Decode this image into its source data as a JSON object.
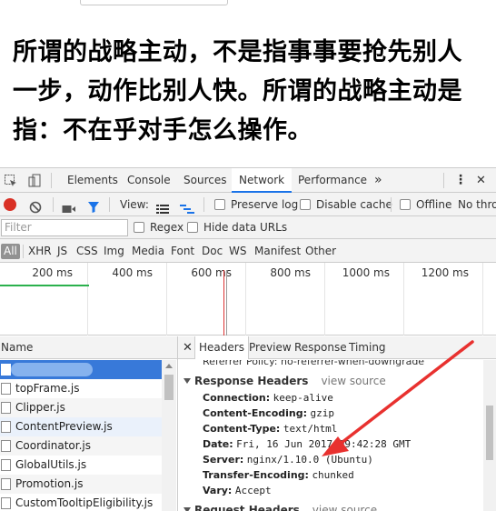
{
  "article": {
    "text": "所谓的战略主动，不是指事事要抢先别人一步，动作比别人快。所谓的战略主动是指：不在乎对手怎么操作。"
  },
  "devtools": {
    "tabs": [
      "Elements",
      "Console",
      "Sources",
      "Network",
      "Performance"
    ],
    "active_tab": "Network",
    "more": "»",
    "close": "✕",
    "menu": "⋮"
  },
  "network_toolbar": {
    "view_label": "View:",
    "preserve_log": "Preserve log",
    "disable_cache": "Disable cache",
    "offline": "Offline",
    "no_throttling": "No thro"
  },
  "filter": {
    "placeholder": "Filter",
    "regex": "Regex",
    "hide_data_urls": "Hide data URLs"
  },
  "types": [
    "All",
    "XHR",
    "JS",
    "CSS",
    "Img",
    "Media",
    "Font",
    "Doc",
    "WS",
    "Manifest",
    "Other"
  ],
  "overview": {
    "ticks": [
      "200 ms",
      "400 ms",
      "600 ms",
      "800 ms",
      "1000 ms",
      "1200 ms"
    ]
  },
  "requests": {
    "header": "Name",
    "items": [
      "topFrame.js",
      "Clipper.js",
      "ContentPreview.js",
      "Coordinator.js",
      "GlobalUtils.js",
      "Promotion.js",
      "CustomTooltipEligibility.js"
    ]
  },
  "detail": {
    "tabs": [
      "Headers",
      "Preview",
      "Response",
      "Timing"
    ],
    "active_tab": "Headers",
    "cut_line": "Referrer Policy: no-referrer-when-downgrade",
    "response_section": "Response Headers",
    "view_source": "view source",
    "headers": [
      {
        "k": "Connection:",
        "v": "keep-alive"
      },
      {
        "k": "Content-Encoding:",
        "v": "gzip"
      },
      {
        "k": "Content-Type:",
        "v": "text/html"
      },
      {
        "k": "Date:",
        "v": "Fri, 16 Jun 2017 09:42:28 GMT"
      },
      {
        "k": "Server:",
        "v": "nginx/1.10.0 (Ubuntu)"
      },
      {
        "k": "Transfer-Encoding:",
        "v": "chunked"
      },
      {
        "k": "Vary:",
        "v": "Accept"
      }
    ],
    "request_section": "Request Headers"
  },
  "colors": {
    "annotation_arrow": "#e8312f",
    "selected_row": "#3879d9",
    "record": "#d93025"
  }
}
